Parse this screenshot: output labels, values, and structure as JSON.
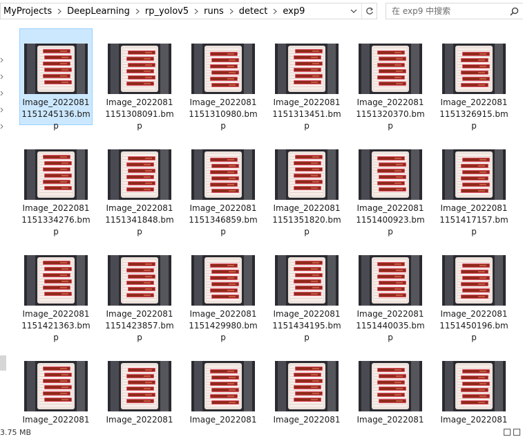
{
  "breadcrumb": [
    "MyProjects",
    "DeepLearning",
    "rp_yolov5",
    "runs",
    "detect",
    "exp9"
  ],
  "search": {
    "placeholder": "在 exp9 中搜索"
  },
  "icons": {
    "dropdown": "chevron-down-icon",
    "refresh": "refresh-icon",
    "search": "search-icon",
    "separator": "chevron-right-icon"
  },
  "files": [
    {
      "name": "Image_20220811151245136.bmp",
      "selected": true
    },
    {
      "name": "Image_20220811151308091.bmp"
    },
    {
      "name": "Image_20220811151310980.bmp"
    },
    {
      "name": "Image_20220811151313451.bmp"
    },
    {
      "name": "Image_20220811151320370.bmp"
    },
    {
      "name": "Image_20220811151326915.bmp"
    },
    {
      "name": "Image_20220811151334276.bmp"
    },
    {
      "name": "Image_20220811151341848.bmp"
    },
    {
      "name": "Image_20220811151346859.bmp"
    },
    {
      "name": "Image_20220811151351820.bmp"
    },
    {
      "name": "Image_20220811151400923.bmp"
    },
    {
      "name": "Image_20220811151417157.bmp"
    },
    {
      "name": "Image_20220811151421363.bmp"
    },
    {
      "name": "Image_20220811151423857.bmp"
    },
    {
      "name": "Image_20220811151429980.bmp"
    },
    {
      "name": "Image_20220811151434195.bmp"
    },
    {
      "name": "Image_20220811151440035.bmp"
    },
    {
      "name": "Image_20220811151450196.bmp"
    },
    {
      "name": "Image_2022081"
    },
    {
      "name": "Image_2022081"
    },
    {
      "name": "Image_2022081"
    },
    {
      "name": "Image_2022081"
    },
    {
      "name": "Image_2022081"
    },
    {
      "name": "Image_2022081"
    }
  ],
  "status": {
    "size_text": "3.75 MB"
  },
  "colors": {
    "selection_bg": "#cce8ff",
    "selection_border": "#99d1ff",
    "vial": "#8f2a1a"
  }
}
